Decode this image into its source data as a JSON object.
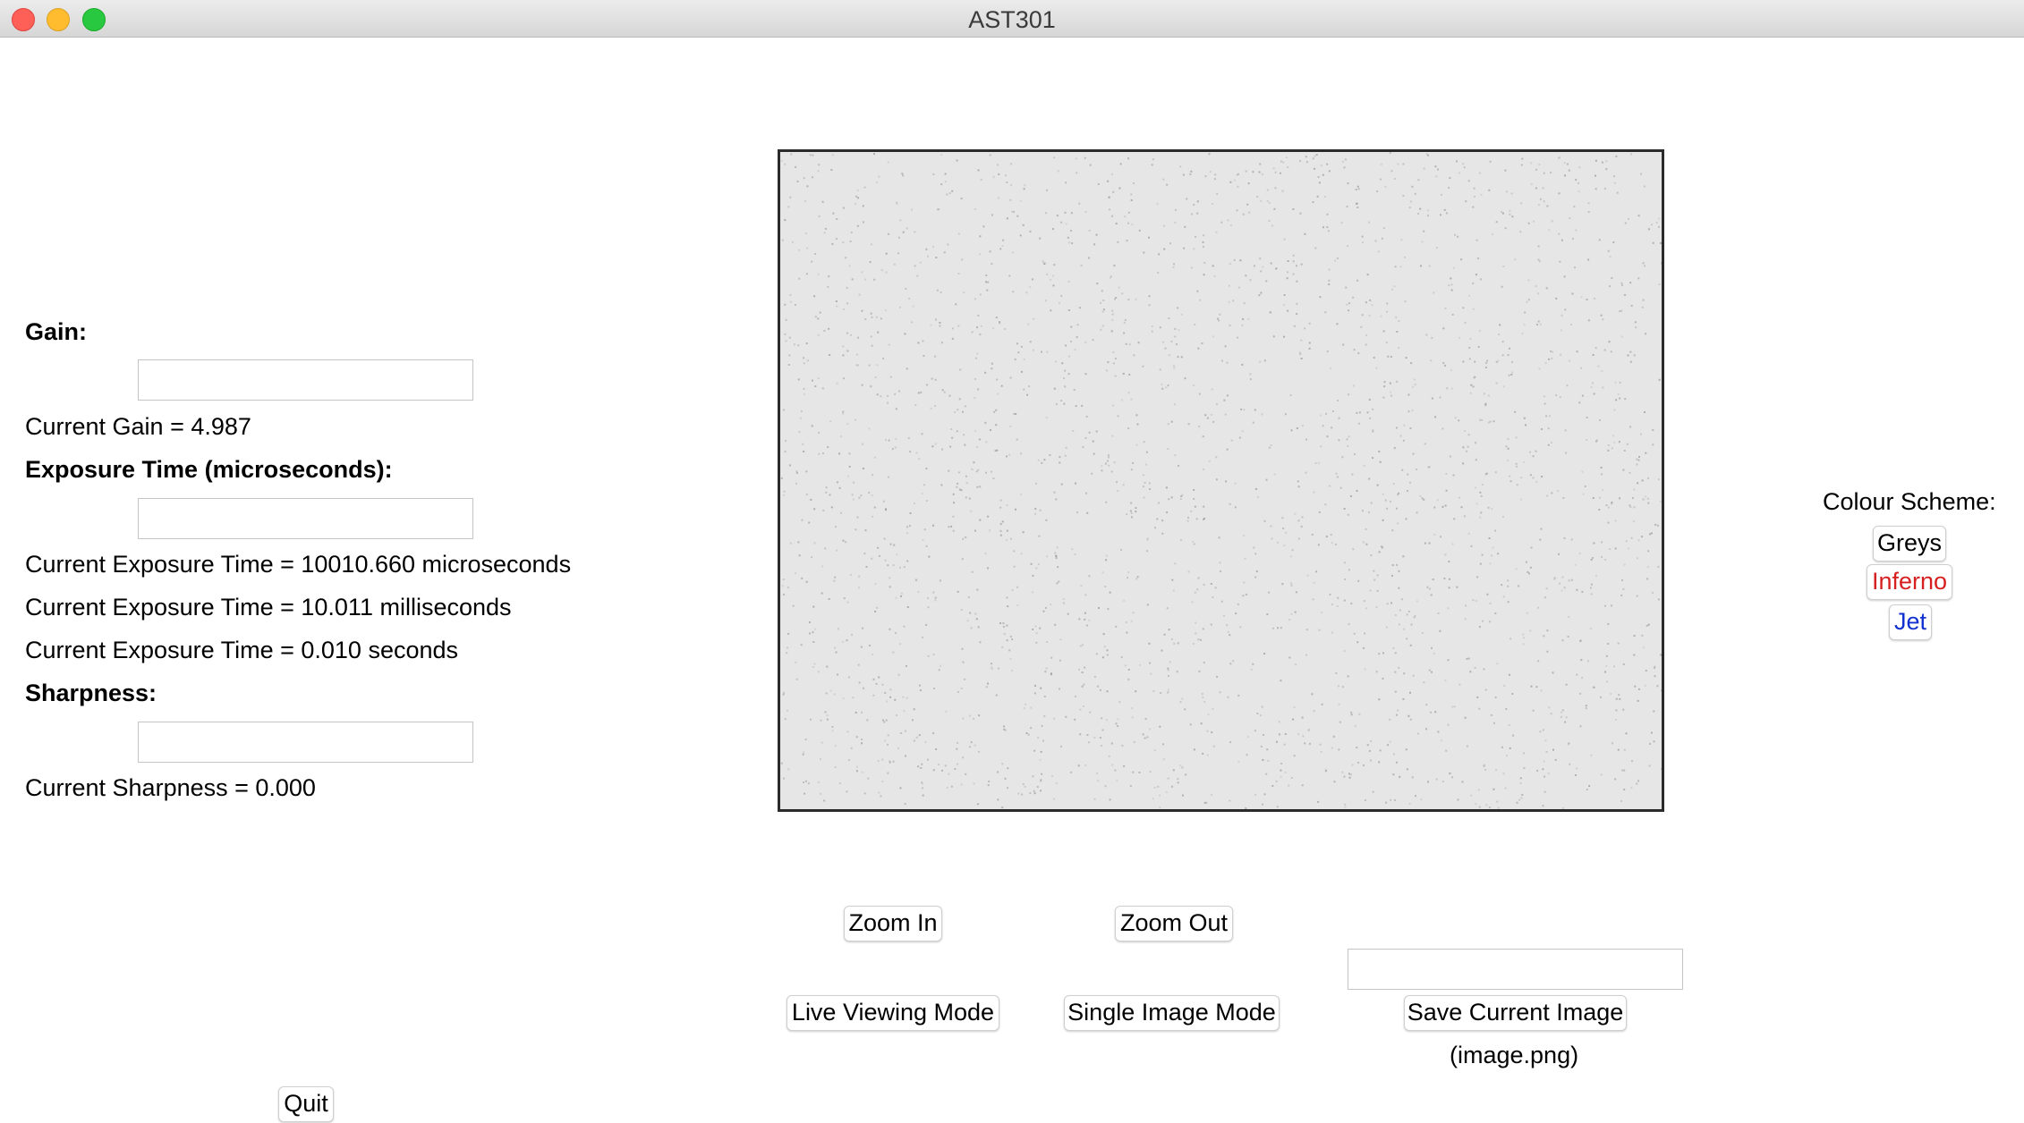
{
  "window": {
    "title": "AST301"
  },
  "gain": {
    "heading": "Gain:",
    "input_value": "",
    "current": "Current Gain = 4.987"
  },
  "exposure": {
    "heading": "Exposure Time (microseconds):",
    "input_value": "",
    "current_us": "Current Exposure Time = 10010.660 microseconds",
    "current_ms": "Current Exposure Time = 10.011 milliseconds",
    "current_s": "Current Exposure Time = 0.010 seconds"
  },
  "sharpness": {
    "heading": "Sharpness:",
    "input_value": "",
    "current": "Current Sharpness = 0.000"
  },
  "quit_label": "Quit",
  "colour_scheme": {
    "heading": "Colour Scheme:",
    "greys": "Greys",
    "inferno": "Inferno",
    "jet": "Jet",
    "inferno_color": "#d62020",
    "jet_color": "#1030d0"
  },
  "controls": {
    "zoom_in": "Zoom In",
    "zoom_out": "Zoom Out",
    "live_mode": "Live Viewing Mode",
    "single_mode": "Single Image Mode",
    "save_filename_value": "",
    "save_label": "Save Current Image",
    "save_hint": "(image.png)"
  },
  "viewer": {
    "background": "#e6e6e6",
    "noise_color": "#9a9a9a"
  }
}
